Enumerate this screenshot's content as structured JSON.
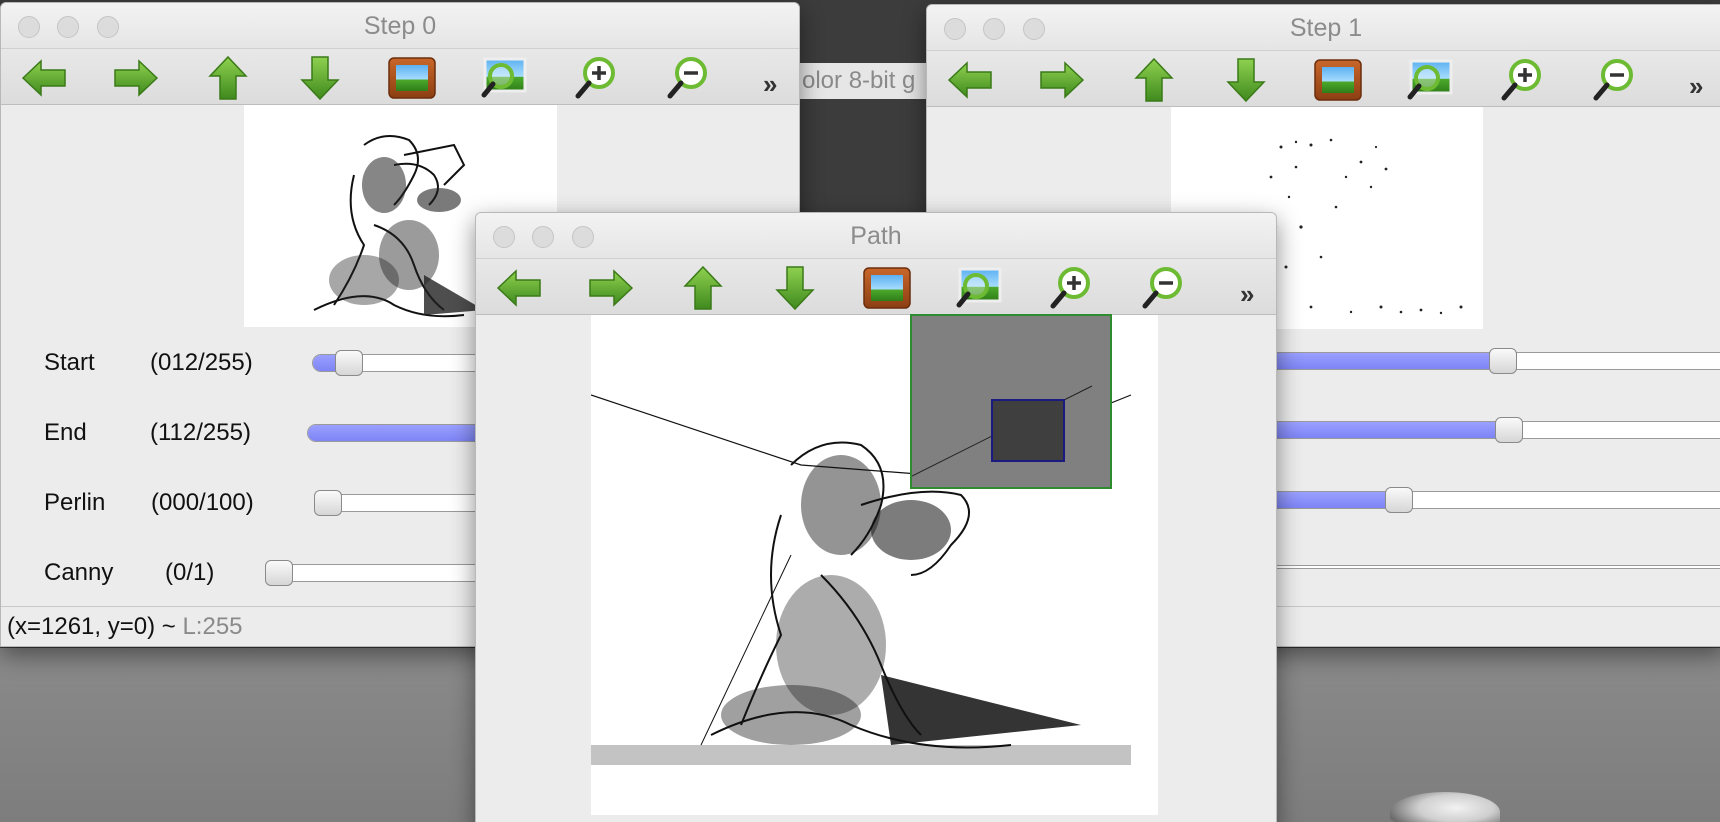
{
  "desktop": {
    "background_window_title_fragment": "olor 8-bit g"
  },
  "toolbar_icons": [
    "arrow-left-icon",
    "arrow-right-icon",
    "arrow-up-icon",
    "arrow-down-icon",
    "image-frame-icon",
    "zoom-fit-icon",
    "zoom-in-icon",
    "zoom-out-icon"
  ],
  "toolbar_overflow": "»",
  "windows": {
    "step0": {
      "title": "Step 0",
      "sliders": [
        {
          "label": "Start",
          "value": "(012/255)",
          "fraction": 0.047
        },
        {
          "label": "End",
          "value": "(112/255)",
          "fraction": 0.439
        },
        {
          "label": "Perlin",
          "value": "(000/100)",
          "fraction": 0.0
        },
        {
          "label": "Canny",
          "value": "(0/1)",
          "fraction": 0.0
        }
      ],
      "status": {
        "coords": "(x=1261, y=0) ~",
        "luma": "L:255"
      }
    },
    "step1": {
      "title": "Step 1"
    },
    "path": {
      "title": "Path"
    }
  },
  "colors": {
    "icon_green": "#5aa02c",
    "slider_fill": "#8a90fa",
    "overview_green_border": "#2e8b2e",
    "viewport_navy_border": "#1a1a80"
  }
}
